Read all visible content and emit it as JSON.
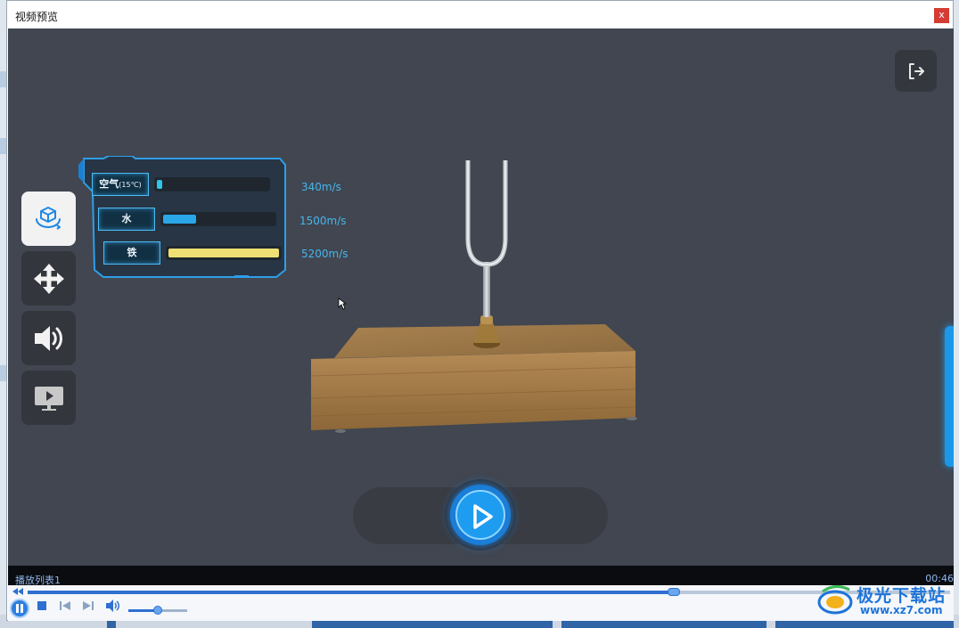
{
  "window": {
    "title": "视频预览",
    "close_label": "x"
  },
  "video": {
    "exit_icon": "exit-icon",
    "tools": [
      {
        "name": "rotate-3d-tool",
        "icon": "cube-rotate-icon",
        "active": true
      },
      {
        "name": "move-tool",
        "icon": "move-arrows-icon",
        "active": false
      },
      {
        "name": "sound-tool",
        "icon": "speaker-icon",
        "active": false
      },
      {
        "name": "screen-tool",
        "icon": "monitor-play-icon",
        "active": false
      }
    ],
    "speed_panel": {
      "rows": [
        {
          "medium": "空气",
          "note": "(15℃)",
          "speed": "340m/s",
          "level": 0.05,
          "color": "#2ec7e8"
        },
        {
          "medium": "水",
          "note": "",
          "speed": "1500m/s",
          "level": 0.3,
          "color": "#29a7e8"
        },
        {
          "medium": "铁",
          "note": "",
          "speed": "5200m/s",
          "level": 1.0,
          "color": "#efe073"
        }
      ]
    },
    "play_icon": "play-icon"
  },
  "player": {
    "playlist_label": "播放列表1",
    "time": "00:46",
    "progress": 0.7,
    "volume": 0.5
  },
  "watermark": {
    "text": "极光下载站",
    "url": "www.xz7.com"
  }
}
